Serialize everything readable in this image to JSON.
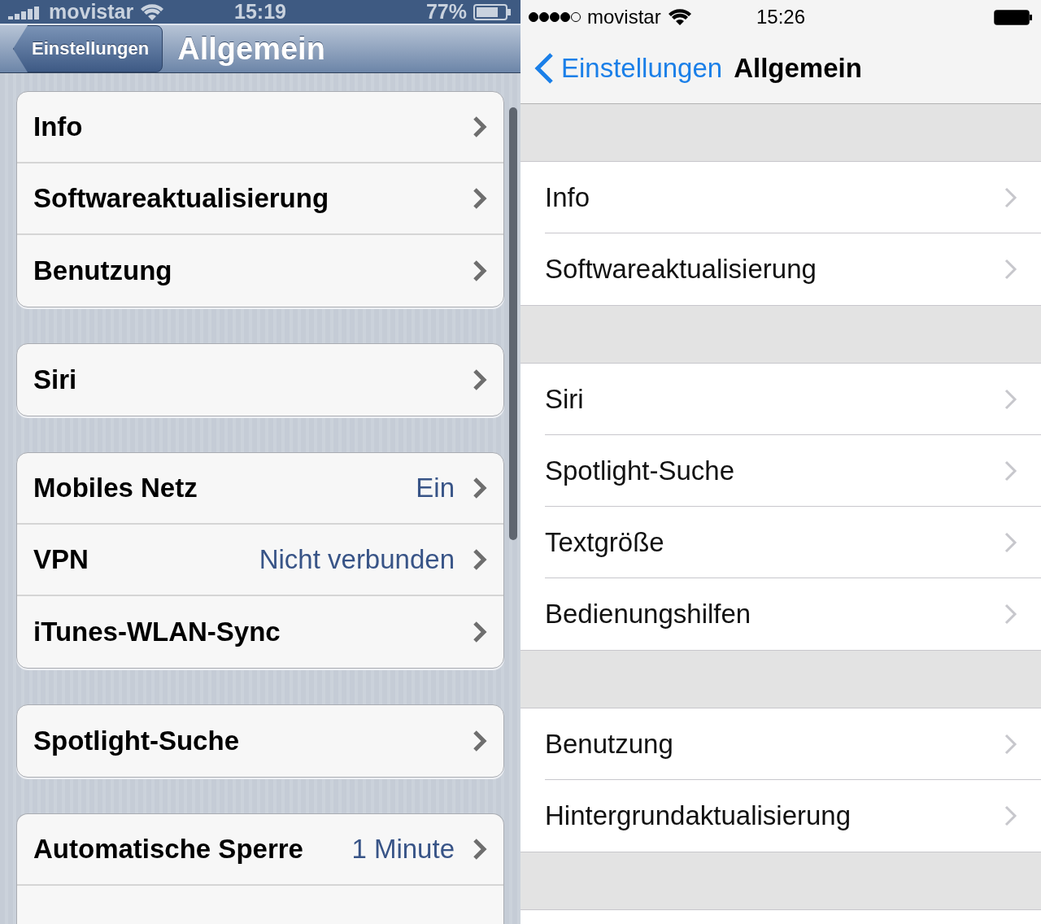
{
  "panels": [
    {
      "kind": "skeuomorphic",
      "status_bar": {
        "carrier": "movistar",
        "time": "15:19",
        "battery": "77%"
      },
      "nav_bar": {
        "back_button": "Einstellungen",
        "title": "Allgemein"
      },
      "groups": [
        {
          "rows": [
            {
              "label": "Info"
            },
            {
              "label": "Softwareaktualisierung"
            },
            {
              "label": "Benutzung"
            }
          ]
        },
        {
          "rows": [
            {
              "label": "Siri"
            }
          ]
        },
        {
          "rows": [
            {
              "label": "Mobiles Netz",
              "value": "Ein"
            },
            {
              "label": "VPN",
              "value": "Nicht verbunden"
            },
            {
              "label": "iTunes-WLAN-Sync"
            }
          ]
        },
        {
          "rows": [
            {
              "label": "Spotlight-Suche"
            }
          ]
        },
        {
          "rows": [
            {
              "label": "Automatische Sperre",
              "value": "1 Minute"
            }
          ]
        }
      ]
    },
    {
      "kind": "flat",
      "status_bar": {
        "carrier": "movistar",
        "time": "15:26"
      },
      "nav_bar": {
        "back_button": "Einstellungen",
        "title": "Allgemein"
      },
      "groups": [
        {
          "rows": [
            {
              "label": "Info"
            },
            {
              "label": "Softwareaktualisierung"
            }
          ]
        },
        {
          "rows": [
            {
              "label": "Siri"
            },
            {
              "label": "Spotlight-Suche"
            },
            {
              "label": "Textgröße"
            },
            {
              "label": "Bedienungshilfen"
            }
          ]
        },
        {
          "rows": [
            {
              "label": "Benutzung"
            },
            {
              "label": "Hintergrundaktualisierung"
            }
          ]
        }
      ]
    }
  ]
}
